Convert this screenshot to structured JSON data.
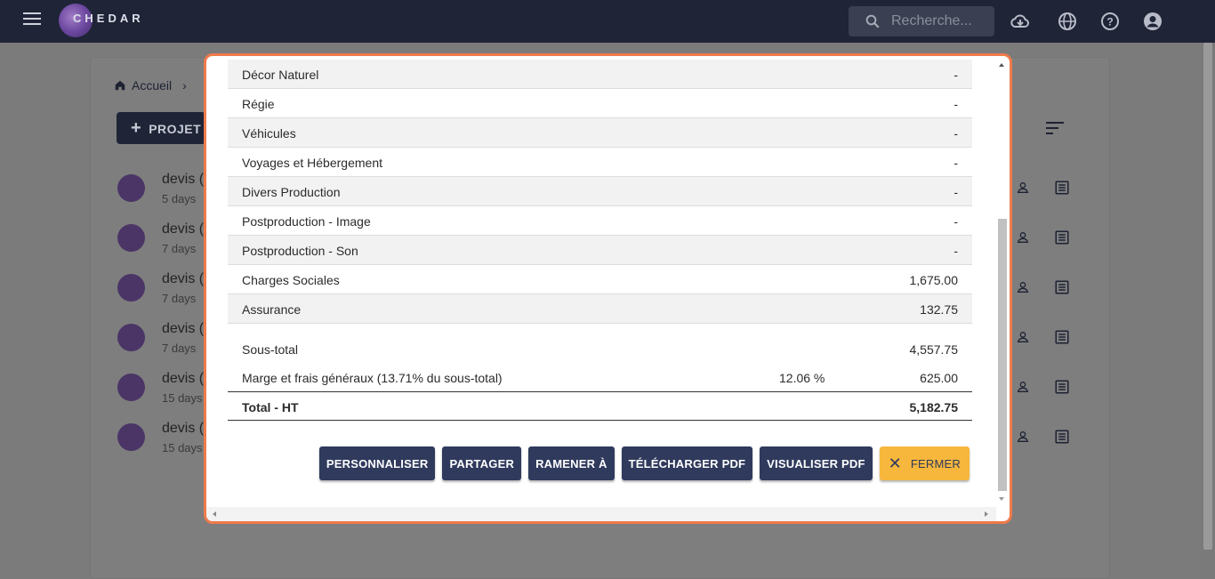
{
  "app": {
    "logo_text": "CHEDAR"
  },
  "search": {
    "placeholder": "Recherche..."
  },
  "breadcrumb": {
    "home": "Accueil"
  },
  "toolbar": {
    "new_project_label": "PROJET"
  },
  "projects": [
    {
      "title": "devis (",
      "age": "5 days"
    },
    {
      "title": "devis (",
      "age": "7 days"
    },
    {
      "title": "devis (",
      "age": "7 days"
    },
    {
      "title": "devis (",
      "age": "7 days"
    },
    {
      "title": "devis (",
      "age": "15 days"
    },
    {
      "title": "devis (",
      "age": "15 days"
    }
  ],
  "modal": {
    "rows": [
      {
        "label": "Décor Naturel",
        "value": "-"
      },
      {
        "label": "Régie",
        "value": "-"
      },
      {
        "label": "Véhicules",
        "value": "-"
      },
      {
        "label": "Voyages et Hébergement",
        "value": "-"
      },
      {
        "label": "Divers Production",
        "value": "-"
      },
      {
        "label": "Postproduction - Image",
        "value": "-"
      },
      {
        "label": "Postproduction - Son",
        "value": "-"
      },
      {
        "label": "Charges Sociales",
        "value": "1,675.00"
      },
      {
        "label": "Assurance",
        "value": "132.75"
      }
    ],
    "subtotal": {
      "label": "Sous-total",
      "value": "4,557.75"
    },
    "margin": {
      "label": "Marge et frais généraux (13.71% du sous-total)",
      "percent": "12.06 %",
      "value": "625.00"
    },
    "total": {
      "label": "Total - HT",
      "value": "5,182.75"
    },
    "buttons": {
      "customize": "PERSONNALISER",
      "share": "PARTAGER",
      "bring_back": "RAMENER À",
      "download_pdf": "TÉLÉCHARGER PDF",
      "view_pdf": "VISUALISER PDF",
      "close": "FERMER"
    }
  },
  "colors": {
    "accent": "#f07a4b",
    "primary": "#2f3a5d",
    "close_button": "#f6b73c",
    "topbar": "#1f2437"
  }
}
